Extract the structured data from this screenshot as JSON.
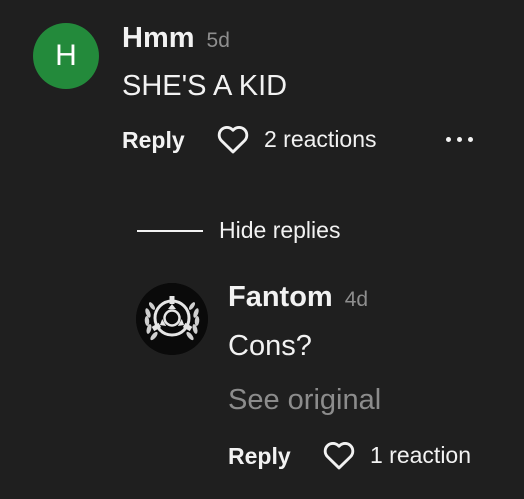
{
  "comment": {
    "avatar_letter": "H",
    "avatar_color": "#238a3b",
    "author": "Hmm",
    "age": "5d",
    "text": "SHE'S A KID",
    "reply_label": "Reply",
    "reactions_label": "2 reactions",
    "reaction_icon": "heart-outline-icon",
    "more_icon": "more-dots-icon"
  },
  "replies_toggle": {
    "label": "Hide replies"
  },
  "reply": {
    "avatar_icon": "scp-emblem-icon",
    "author": "Fantom",
    "age": "4d",
    "text": "Cons?",
    "see_original_label": "See original",
    "reply_label": "Reply",
    "reactions_label": "1 reaction",
    "reaction_icon": "heart-outline-icon"
  }
}
